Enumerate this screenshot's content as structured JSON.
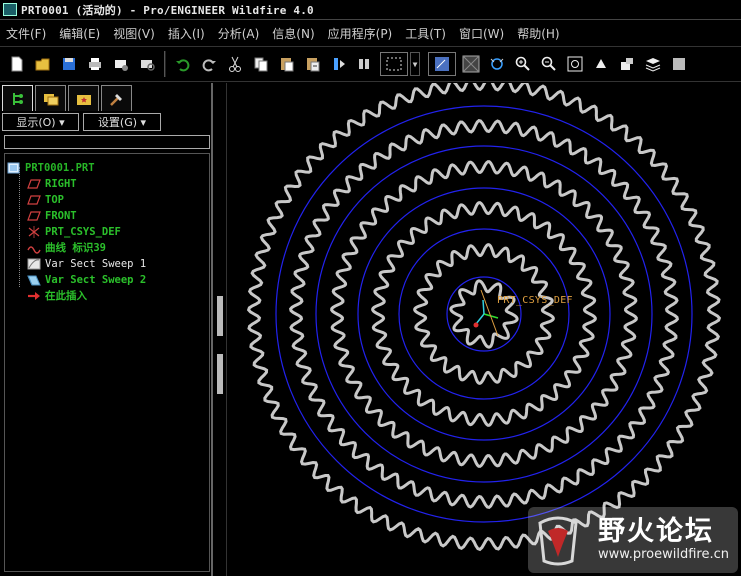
{
  "window": {
    "title": "PRT0001 (活动的) - Pro/ENGINEER Wildfire 4.0"
  },
  "menu": [
    {
      "label": "文件(F)"
    },
    {
      "label": "编辑(E)"
    },
    {
      "label": "视图(V)"
    },
    {
      "label": "插入(I)"
    },
    {
      "label": "分析(A)"
    },
    {
      "label": "信息(N)"
    },
    {
      "label": "应用程序(P)"
    },
    {
      "label": "工具(T)"
    },
    {
      "label": "窗口(W)"
    },
    {
      "label": "帮助(H)"
    }
  ],
  "navigator": {
    "show_label": "显示(O) ▾",
    "settings_label": "设置(G) ▾",
    "tree": [
      {
        "label": "PRT0001.PRT",
        "icon": "part-icon"
      },
      {
        "label": "RIGHT",
        "icon": "datum-plane-icon"
      },
      {
        "label": "TOP",
        "icon": "datum-plane-icon"
      },
      {
        "label": "FRONT",
        "icon": "datum-plane-icon"
      },
      {
        "label": "PRT_CSYS_DEF",
        "icon": "csys-icon"
      },
      {
        "label": "曲线 标识39",
        "icon": "curve-icon"
      },
      {
        "label": "Var Sect Sweep 1",
        "icon": "sweep-icon"
      },
      {
        "label": "Var Sect Sweep 2",
        "icon": "sweep-icon"
      },
      {
        "label": "在此插入",
        "icon": "insert-here-arrow-icon"
      }
    ]
  },
  "graphics": {
    "csys_label": "PRT_CSYS_DEF",
    "colors": {
      "background": "#000000",
      "circle": "#2222ee",
      "wave": "#c8c8c8",
      "csys_label": "#e0a040"
    }
  },
  "watermark": {
    "title": "野火论坛",
    "url": "www.proewildfire.cn"
  }
}
